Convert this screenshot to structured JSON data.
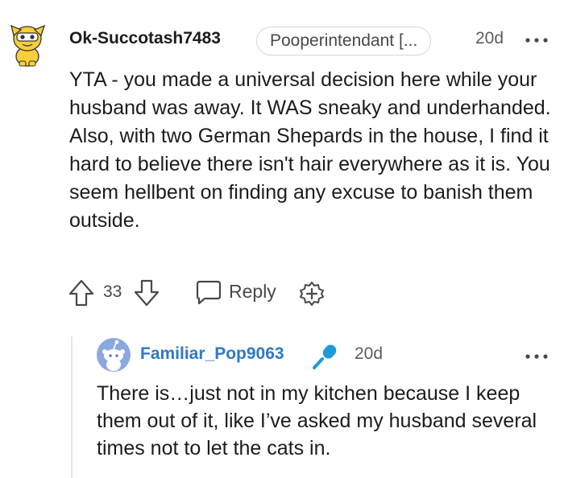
{
  "comment": {
    "author": "Ok-Succotash7483",
    "flair": "Pooperintendant [...",
    "age": "20d",
    "body": "YTA - you made a universal decision here while your husband was away. It WAS sneaky and underhanded. Also, with two German Shepards in the house, I find it hard to believe there isn't hair everywhere as it is. You seem hellbent on finding any excuse to banish them outside.",
    "score": "33",
    "reply_label": "Reply"
  },
  "reply": {
    "author": "Familiar_Pop9063",
    "age": "20d",
    "body": "There is…just not in my kitchen because I keep them out of it, like I’ve asked my husband several times not to let the cats in."
  },
  "icons": {
    "avatar_main": "snoo-avatar-yellow-costume",
    "menu": "more-dots-icon",
    "upvote": "upvote-arrow-icon",
    "downvote": "downvote-arrow-icon",
    "reply": "speech-bubble-icon",
    "award": "award-plus-icon",
    "avatar_reply": "default-snoo-avatar-blue",
    "mic": "microphone-icon"
  },
  "colors": {
    "reply_author": "#2f78c6",
    "mic": "#1f9bd9",
    "avatar_reply_bg": "#8aa8e0",
    "flair_border": "#d4d7da"
  }
}
